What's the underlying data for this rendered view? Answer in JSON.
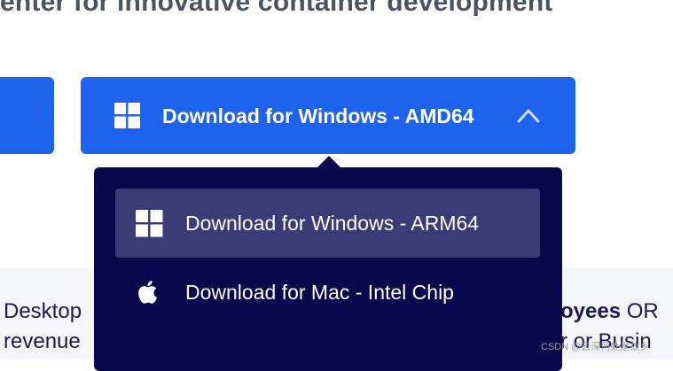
{
  "page": {
    "headline": "enter for innovative container development",
    "band": {
      "left_line1": "Desktop",
      "left_line2": "revenue",
      "right_line1_bold": "oyees",
      "right_line1_rest": " OR",
      "right_line2": "r or Busin"
    },
    "watermark": "CSDN @云深何处是故乡"
  },
  "main_button": {
    "label": "Download for Windows - AMD64",
    "icon": "windows-icon",
    "toggle_icon": "chevron-up-icon",
    "color": "#1d63ed"
  },
  "dropdown": {
    "background": "#08084c",
    "items": [
      {
        "label": "Download for Windows - ARM64",
        "icon": "windows-icon",
        "active": true
      },
      {
        "label": "Download for Mac - Intel Chip",
        "icon": "apple-icon",
        "active": false
      }
    ]
  }
}
